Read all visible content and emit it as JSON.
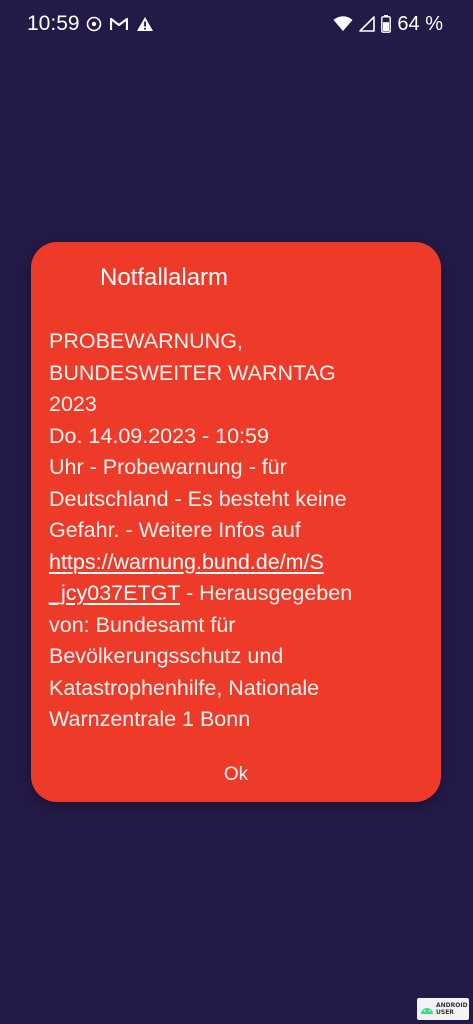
{
  "status_bar": {
    "time": "10:59",
    "battery_percent": "64 %",
    "icons": [
      "focus-icon",
      "gmail-icon",
      "alert-icon",
      "wifi-icon",
      "cell-signal-icon",
      "battery-icon"
    ]
  },
  "dialog": {
    "title": "Notfallalarm",
    "message_lines": [
      "PROBEWARNUNG,",
      "BUNDESWEITER WARNTAG",
      "2023",
      "Do. 14.09.2023 - 10:59",
      "Uhr - Probewarnung - für",
      "Deutschland - Es besteht keine",
      "Gefahr. - Weitere Infos auf"
    ],
    "link_line_1": "https://warnung.bund.de/m/S",
    "link_line_2": "_jcy037ETGT",
    "after_link": " - Herausgegeben",
    "message_lines_end": [
      "von: Bundesamt für",
      "Bevölkerungsschutz und",
      "Katastrophenhilfe, Nationale",
      "Warnzentrale 1 Bonn"
    ],
    "ok_label": "Ok"
  },
  "watermark": {
    "line1": "ANDROID",
    "line2": "USER"
  },
  "colors": {
    "background": "#241a47",
    "dialog": "#ee3a29",
    "text": "#ffffff"
  }
}
